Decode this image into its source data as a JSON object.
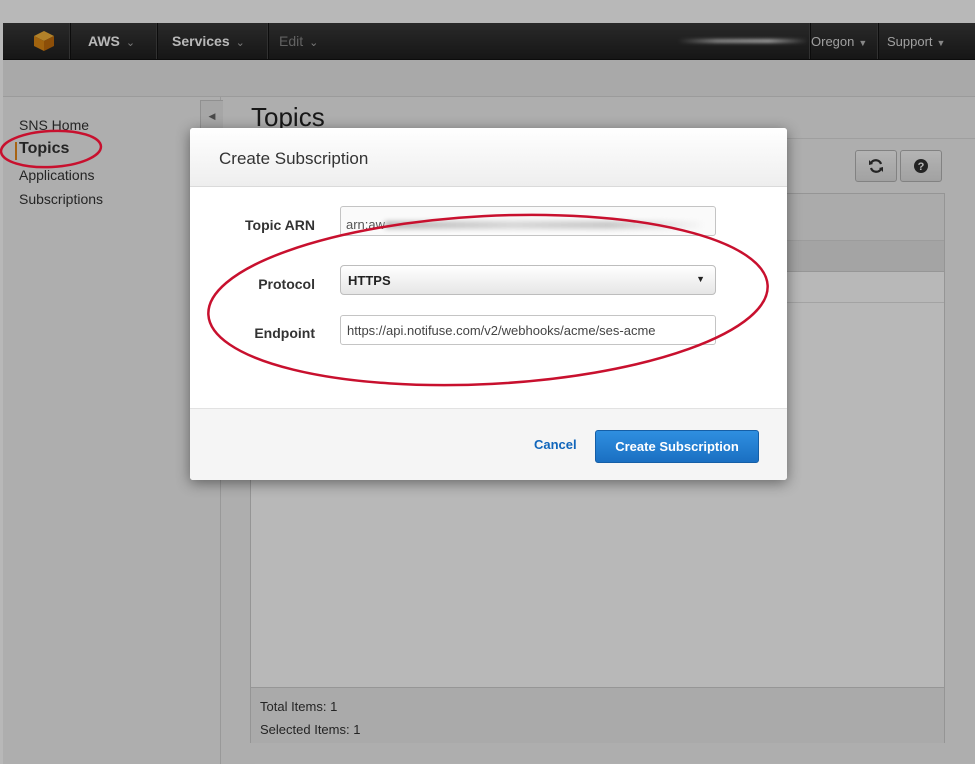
{
  "navbar": {
    "brand": "AWS",
    "services": "Services",
    "edit": "Edit",
    "region": "Oregon",
    "support": "Support"
  },
  "sidebar": {
    "items": [
      {
        "label": "SNS Home"
      },
      {
        "label": "Topics"
      },
      {
        "label": "Applications"
      },
      {
        "label": "Subscriptions"
      }
    ]
  },
  "main": {
    "title": "Topics",
    "footer": {
      "total": "Total Items: 1",
      "selected": "Selected Items: 1"
    }
  },
  "modal": {
    "title": "Create Subscription",
    "topic_arn_label": "Topic ARN",
    "topic_arn_value": "arn:aw",
    "protocol_label": "Protocol",
    "protocol_value": "HTTPS",
    "endpoint_label": "Endpoint",
    "endpoint_value": "https://api.notifuse.com/v2/webhooks/acme/ses-acme",
    "cancel_label": "Cancel",
    "submit_label": "Create Subscription"
  },
  "colors": {
    "annotation": "#c8102e",
    "primary": "#1f7ad0",
    "link": "#1166bb",
    "accent": "#e88a1a"
  },
  "icons": {
    "logo": "aws-cube-icon",
    "refresh": "refresh-icon",
    "help": "help-icon"
  }
}
